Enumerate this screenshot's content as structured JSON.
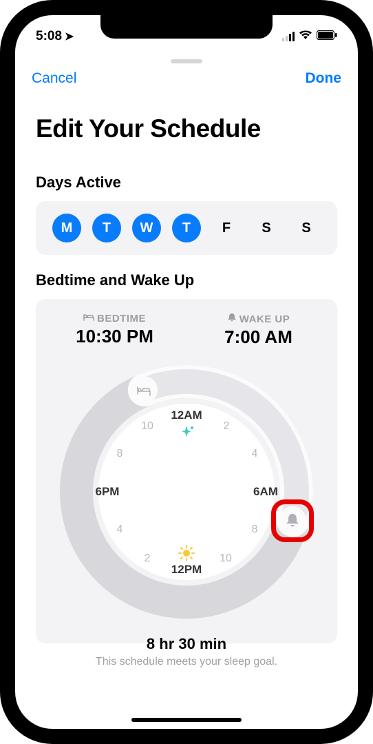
{
  "status": {
    "time": "5:08",
    "location_icon": "➤"
  },
  "nav": {
    "cancel": "Cancel",
    "done": "Done"
  },
  "title": "Edit Your Schedule",
  "days_section": {
    "label": "Days Active",
    "days": [
      {
        "letter": "M",
        "active": true
      },
      {
        "letter": "T",
        "active": true
      },
      {
        "letter": "W",
        "active": true
      },
      {
        "letter": "T",
        "active": true
      },
      {
        "letter": "F",
        "active": false
      },
      {
        "letter": "S",
        "active": false
      },
      {
        "letter": "S",
        "active": false
      }
    ]
  },
  "bedwake": {
    "label": "Bedtime and Wake Up",
    "bedtime_label": "BEDTIME",
    "bedtime_value": "10:30 PM",
    "wakeup_label": "WAKE UP",
    "wakeup_value": "7:00 AM",
    "duration": "8 hr 30 min",
    "goal_hint": "This schedule meets your sleep goal."
  },
  "dial": {
    "top": "12AM",
    "right": "6AM",
    "bottom": "12PM",
    "left": "6PM",
    "hours": [
      "2",
      "4",
      "8",
      "10",
      "2",
      "4",
      "8",
      "10"
    ]
  }
}
